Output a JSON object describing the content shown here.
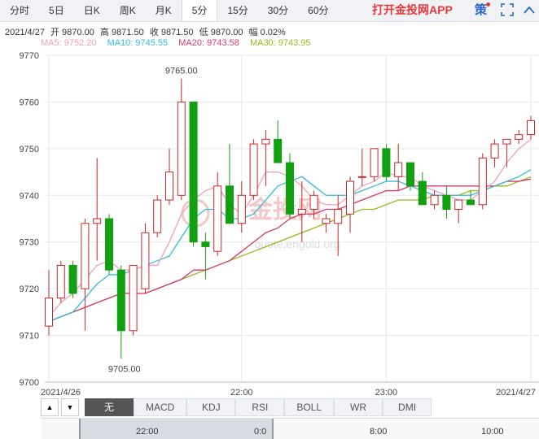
{
  "tabs": [
    {
      "label": "分时",
      "active": false
    },
    {
      "label": "5日",
      "active": false
    },
    {
      "label": "日K",
      "active": false
    },
    {
      "label": "周K",
      "active": false
    },
    {
      "label": "月K",
      "active": false
    },
    {
      "label": "5分",
      "active": true
    },
    {
      "label": "15分",
      "active": false
    },
    {
      "label": "30分",
      "active": false
    },
    {
      "label": "60分",
      "active": false
    }
  ],
  "promo_text": "打开金投网APP",
  "policy_text": "策",
  "info": {
    "date": "2021/4/27",
    "open": "开 9870.00",
    "high": "高 9871.50",
    "close": "收 9871.50",
    "low": "低 9870.00",
    "change": "幅 0.02%"
  },
  "ma": {
    "ma5": "MA5: 9752.20",
    "ma10": "MA10: 9745.55",
    "ma20": "MA20: 9743.58",
    "ma30": "MA30: 9743.95"
  },
  "colors": {
    "up": "#c62828",
    "down": "#10a010",
    "ma5": "#f0a0b8",
    "ma10": "#33bbdd",
    "ma20": "#d63a6a",
    "ma30": "#9ab820",
    "grid": "#e8e8e8"
  },
  "watermark": {
    "brand": "金投网",
    "url": "quote.engold.org"
  },
  "indicators": [
    "无",
    "MACD",
    "KDJ",
    "RSI",
    "BOLL",
    "WR",
    "DMI"
  ],
  "indicator_active": "无",
  "navigator": {
    "labels": [
      "22:00",
      "0:0",
      "8:00",
      "10:00"
    ]
  },
  "chart_data": {
    "type": "candlestick",
    "ylim": [
      9700,
      9770
    ],
    "y_ticks": [
      9700,
      9710,
      9720,
      9730,
      9740,
      9750,
      9760,
      9770
    ],
    "x_labels": [
      "2021/4/26",
      "22:00",
      "23:00",
      "2021/4/27"
    ],
    "x_label_index": [
      0,
      16,
      28,
      40
    ],
    "annotations": [
      {
        "text": "9765.00",
        "index": 11,
        "value": 9765.0
      },
      {
        "text": "9705.00",
        "index": 6,
        "value": 9705.0
      }
    ],
    "candles": [
      {
        "o": 9712,
        "h": 9724,
        "l": 9710,
        "c": 9718
      },
      {
        "o": 9718,
        "h": 9726,
        "l": 9717,
        "c": 9725
      },
      {
        "o": 9725,
        "h": 9726,
        "l": 9718,
        "c": 9719
      },
      {
        "o": 9720,
        "h": 9735,
        "l": 9711,
        "c": 9734
      },
      {
        "o": 9734,
        "h": 9748,
        "l": 9726,
        "c": 9735
      },
      {
        "o": 9735,
        "h": 9736,
        "l": 9723,
        "c": 9724
      },
      {
        "o": 9724,
        "h": 9725,
        "l": 9705,
        "c": 9711
      },
      {
        "o": 9711,
        "h": 9725,
        "l": 9710,
        "c": 9725
      },
      {
        "o": 9720,
        "h": 9734,
        "l": 9719,
        "c": 9732
      },
      {
        "o": 9732,
        "h": 9740,
        "l": 9731,
        "c": 9739
      },
      {
        "o": 9739,
        "h": 9750,
        "l": 9738,
        "c": 9745
      },
      {
        "o": 9740,
        "h": 9765,
        "l": 9739,
        "c": 9760
      },
      {
        "o": 9760,
        "h": 9760,
        "l": 9729,
        "c": 9730
      },
      {
        "o": 9730,
        "h": 9732,
        "l": 9722,
        "c": 9729
      },
      {
        "o": 9728,
        "h": 9745,
        "l": 9727,
        "c": 9742
      },
      {
        "o": 9742,
        "h": 9751,
        "l": 9738,
        "c": 9734
      },
      {
        "o": 9734,
        "h": 9743,
        "l": 9732,
        "c": 9740
      },
      {
        "o": 9740,
        "h": 9752,
        "l": 9739,
        "c": 9751
      },
      {
        "o": 9751,
        "h": 9754,
        "l": 9742,
        "c": 9752
      },
      {
        "o": 9752,
        "h": 9756,
        "l": 9747,
        "c": 9747
      },
      {
        "o": 9747,
        "h": 9749,
        "l": 9735,
        "c": 9736
      },
      {
        "o": 9736,
        "h": 9743,
        "l": 9730,
        "c": 9737
      },
      {
        "o": 9737,
        "h": 9741,
        "l": 9735,
        "c": 9740
      },
      {
        "o": 9734,
        "h": 9736,
        "l": 9732,
        "c": 9735
      },
      {
        "o": 9734,
        "h": 9740,
        "l": 9727,
        "c": 9737
      },
      {
        "o": 9736,
        "h": 9744,
        "l": 9732,
        "c": 9743
      },
      {
        "o": 9744,
        "h": 9750,
        "l": 9742,
        "c": 9744
      },
      {
        "o": 9744,
        "h": 9750,
        "l": 9743,
        "c": 9750
      },
      {
        "o": 9750,
        "h": 9751,
        "l": 9743,
        "c": 9744
      },
      {
        "o": 9744,
        "h": 9751,
        "l": 9741,
        "c": 9747
      },
      {
        "o": 9747,
        "h": 9747,
        "l": 9741,
        "c": 9742
      },
      {
        "o": 9743,
        "h": 9745,
        "l": 9738,
        "c": 9738
      },
      {
        "o": 9738,
        "h": 9741,
        "l": 9737,
        "c": 9740
      },
      {
        "o": 9740,
        "h": 9742,
        "l": 9735,
        "c": 9737
      },
      {
        "o": 9737,
        "h": 9739,
        "l": 9734,
        "c": 9739
      },
      {
        "o": 9739,
        "h": 9741,
        "l": 9738,
        "c": 9738
      },
      {
        "o": 9738,
        "h": 9749,
        "l": 9737,
        "c": 9748
      },
      {
        "o": 9748,
        "h": 9752,
        "l": 9746,
        "c": 9751
      },
      {
        "o": 9751,
        "h": 9752,
        "l": 9746,
        "c": 9752
      },
      {
        "o": 9752,
        "h": 9754,
        "l": 9751,
        "c": 9753
      },
      {
        "o": 9753,
        "h": 9757,
        "l": 9752,
        "c": 9756
      }
    ],
    "ma5": [
      9714,
      9717,
      9719,
      9722,
      9725,
      9726,
      9724,
      9724,
      9725,
      9725,
      9730,
      9736,
      9739,
      9741,
      9742,
      9738,
      9736,
      9740,
      9745,
      9745,
      9744,
      9742,
      9739,
      9738,
      9738,
      9740,
      9742,
      9743,
      9745,
      9744,
      9744,
      9742,
      9741,
      9740,
      9739,
      9739,
      9741,
      9743,
      9747,
      9750,
      9752
    ],
    "ma10": [
      9713,
      9714,
      9715,
      9718,
      9721,
      9723,
      9723,
      9724,
      9725,
      9726,
      9727,
      9731,
      9735,
      9737,
      9737,
      9735,
      9735,
      9736,
      9739,
      9742,
      9743,
      9744,
      9742,
      9740,
      9740,
      9740,
      9741,
      9742,
      9743,
      9743,
      9742,
      9741,
      9740,
      9740,
      9740,
      9740,
      9741,
      9742,
      9743,
      9744,
      9745.5
    ],
    "ma20": [
      9713,
      9714,
      9715,
      9716,
      9717,
      9718,
      9719,
      9719,
      9719,
      9720,
      9721,
      9722,
      9724,
      9724,
      9725,
      9726,
      9728,
      9730,
      9732,
      9733,
      9735,
      9736,
      9736,
      9737,
      9737,
      9738,
      9739,
      9740,
      9741,
      9741,
      9742,
      9742,
      9742,
      9742,
      9742,
      9742,
      9742,
      9742,
      9743,
      9743,
      9743.5
    ],
    "ma30": [
      9713,
      9714,
      9715,
      9716,
      9717,
      9718,
      9719,
      9719,
      9719,
      9720,
      9721,
      9722,
      9723,
      9724,
      9725,
      9726,
      9727,
      9728,
      9729,
      9730,
      9731,
      9732,
      9733,
      9734,
      9735,
      9736,
      9737,
      9737,
      9738,
      9739,
      9739,
      9739,
      9740,
      9740,
      9740,
      9741,
      9741,
      9742,
      9742,
      9743,
      9743.95
    ]
  }
}
